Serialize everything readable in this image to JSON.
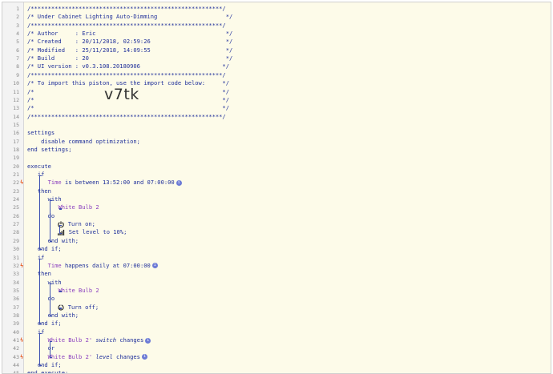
{
  "header_comment": {
    "border": "/********************************************************/",
    "title": "/* Under Cabinet Lighting Auto-Dimming                    */",
    "author": "/* Author     : Eric                                      */",
    "created": "/* Created    : 20/11/2018, 02:59:26                      */",
    "modified": "/* Modified   : 25/11/2018, 14:09:55                      */",
    "build": "/* Build      : 20                                        */",
    "ui_version": "/* UI version : v0.3.108.20180906                        */",
    "import_hint": "/* To import this piston, use the import code below:     */",
    "blank1": "/*                                                       */",
    "import_line": "/*                                                       */",
    "blank2": "/*                                                       */",
    "import_code": "v7tk"
  },
  "code": {
    "settings": "settings",
    "disable_opt": "disable command optimization;",
    "end_settings": "end settings;",
    "execute": "execute",
    "if": "if",
    "then": "then",
    "with": "with",
    "do": "do",
    "or": "or",
    "end_with": "end with;",
    "end_if": "end if;",
    "end_execute": "end execute;",
    "time": "Time",
    "is_between": " is between ",
    "time_start": "13:52:00",
    "and": " and ",
    "time_end": "07:00:00",
    "happens_daily": " happens daily at ",
    "time_daily": "07:00:00",
    "device": "White Bulb 2",
    "turn_on": "Turn on;",
    "set_level_pre": "Set level to ",
    "set_level_val": "10%",
    "set_level_post": ";",
    "turn_off": "Turn off;",
    "dev_q": "White Bulb 2'",
    "switch_changes_a": " switch",
    "changes": " changes",
    "level_changes_a": " level"
  },
  "line_numbers": [
    "1",
    "2",
    "3",
    "4",
    "5",
    "6",
    "7",
    "8",
    "9",
    "10",
    "11",
    "12",
    "13",
    "14",
    "15",
    "16",
    "17",
    "18",
    "19",
    "20",
    "21",
    "22",
    "23",
    "24",
    "25",
    "26",
    "27",
    "28",
    "29",
    "30",
    "31",
    "32",
    "33",
    "34",
    "35",
    "36",
    "37",
    "38",
    "39",
    "40",
    "41",
    "42",
    "43",
    "44",
    "45"
  ],
  "trigger_marker": "ϟ",
  "trigger_lines": [
    "22",
    "32",
    "41",
    "43"
  ],
  "colors": {
    "keyword": "#1f2f9a",
    "device": "#8a3fbf",
    "trigger": "#e8642d",
    "background": "#fdfbe9"
  }
}
